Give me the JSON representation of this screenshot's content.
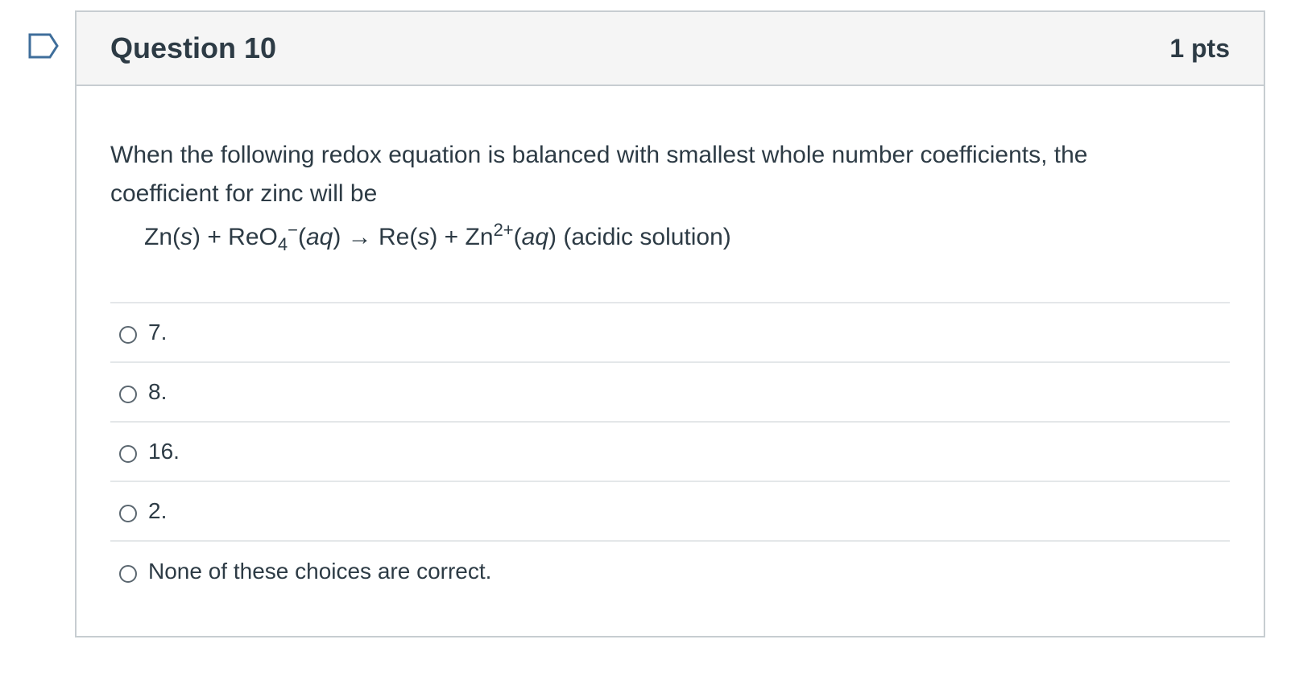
{
  "question": {
    "title": "Question 10",
    "points": "1 pts",
    "text": "When the following redox equation is balanced with smallest whole number coefficients, the coefficient for zinc will be",
    "equation": {
      "reactant1": "Zn(",
      "reactant1_state": "s",
      "reactant1_close": ") + ReO",
      "reactant2_sub": "4",
      "reactant2_sup": "−",
      "reactant2_open": "(",
      "reactant2_state": "aq",
      "reactant2_close": ") → Re(",
      "product1_state": "s",
      "product1_close": ") + Zn",
      "product2_sup": "2+",
      "product2_open": "(",
      "product2_state": "aq",
      "product2_close": ") (acidic solution)"
    }
  },
  "answers": [
    {
      "label": "7."
    },
    {
      "label": "8."
    },
    {
      "label": "16."
    },
    {
      "label": "2."
    },
    {
      "label": "None of these choices are correct."
    }
  ],
  "colors": {
    "text": "#2d3b45",
    "border": "#c7cdd1",
    "header_bg": "#f5f5f5",
    "flag": "#3f6e9b"
  },
  "icons": {
    "flag": "flag-bookmark-icon"
  }
}
